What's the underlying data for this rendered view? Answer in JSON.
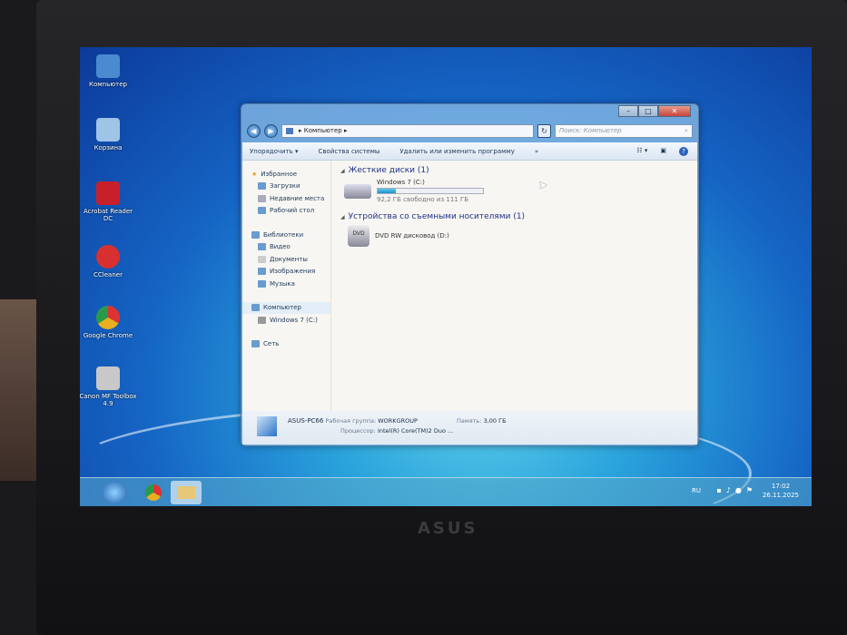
{
  "desktop": {
    "icons": [
      {
        "label": "Компьютер",
        "color": "#4a8ad0"
      },
      {
        "label": "Корзина",
        "color": "#9ec4e6"
      },
      {
        "label": "Acrobat Reader DC",
        "color": "#c8202a"
      },
      {
        "label": "CCleaner",
        "color": "#d83030"
      },
      {
        "label": "Google Chrome",
        "color": "#e8b020"
      },
      {
        "label": "Canon MF Toolbox 4.9",
        "color": "#c8c8c8"
      }
    ]
  },
  "window": {
    "address": "Компьютер",
    "search_placeholder": "Поиск: Компьютер",
    "toolbar": {
      "organize": "Упорядочить ▾",
      "system_props": "Свойства системы",
      "uninstall": "Удалить или изменить программу",
      "more": "»"
    },
    "sidebar": {
      "favorites": "Избранное",
      "downloads": "Загрузки",
      "recent": "Недавние места",
      "desktop": "Рабочий стол",
      "libraries": "Библиотеки",
      "video": "Видео",
      "documents": "Документы",
      "images": "Изображения",
      "music": "Музыка",
      "computer": "Компьютер",
      "drive_c": "Windows 7 (C:)",
      "network": "Сеть"
    },
    "hdd_group": "Жесткие диски (1)",
    "drive_c": {
      "name": "Windows 7 (C:)",
      "free": "92,2 ГБ свободно из 111 ГБ",
      "used_fraction": 0.17
    },
    "removable_group": "Устройства со съемными носителями (1)",
    "dvd": {
      "name": "DVD RW дисковод (D:)"
    },
    "details": {
      "pc_name": "ASUS-PC66",
      "workgroup_label": "Рабочая группа:",
      "workgroup": "WORKGROUP",
      "memory_label": "Память:",
      "memory": "3,00 ГБ",
      "cpu_label": "Процессор:",
      "cpu": "Intel(R) Core(TM)2 Duo ..."
    }
  },
  "taskbar": {
    "lang": "RU",
    "time": "17:02",
    "date": "26.11.2025"
  },
  "bezel": {
    "brand": "ASUS"
  }
}
